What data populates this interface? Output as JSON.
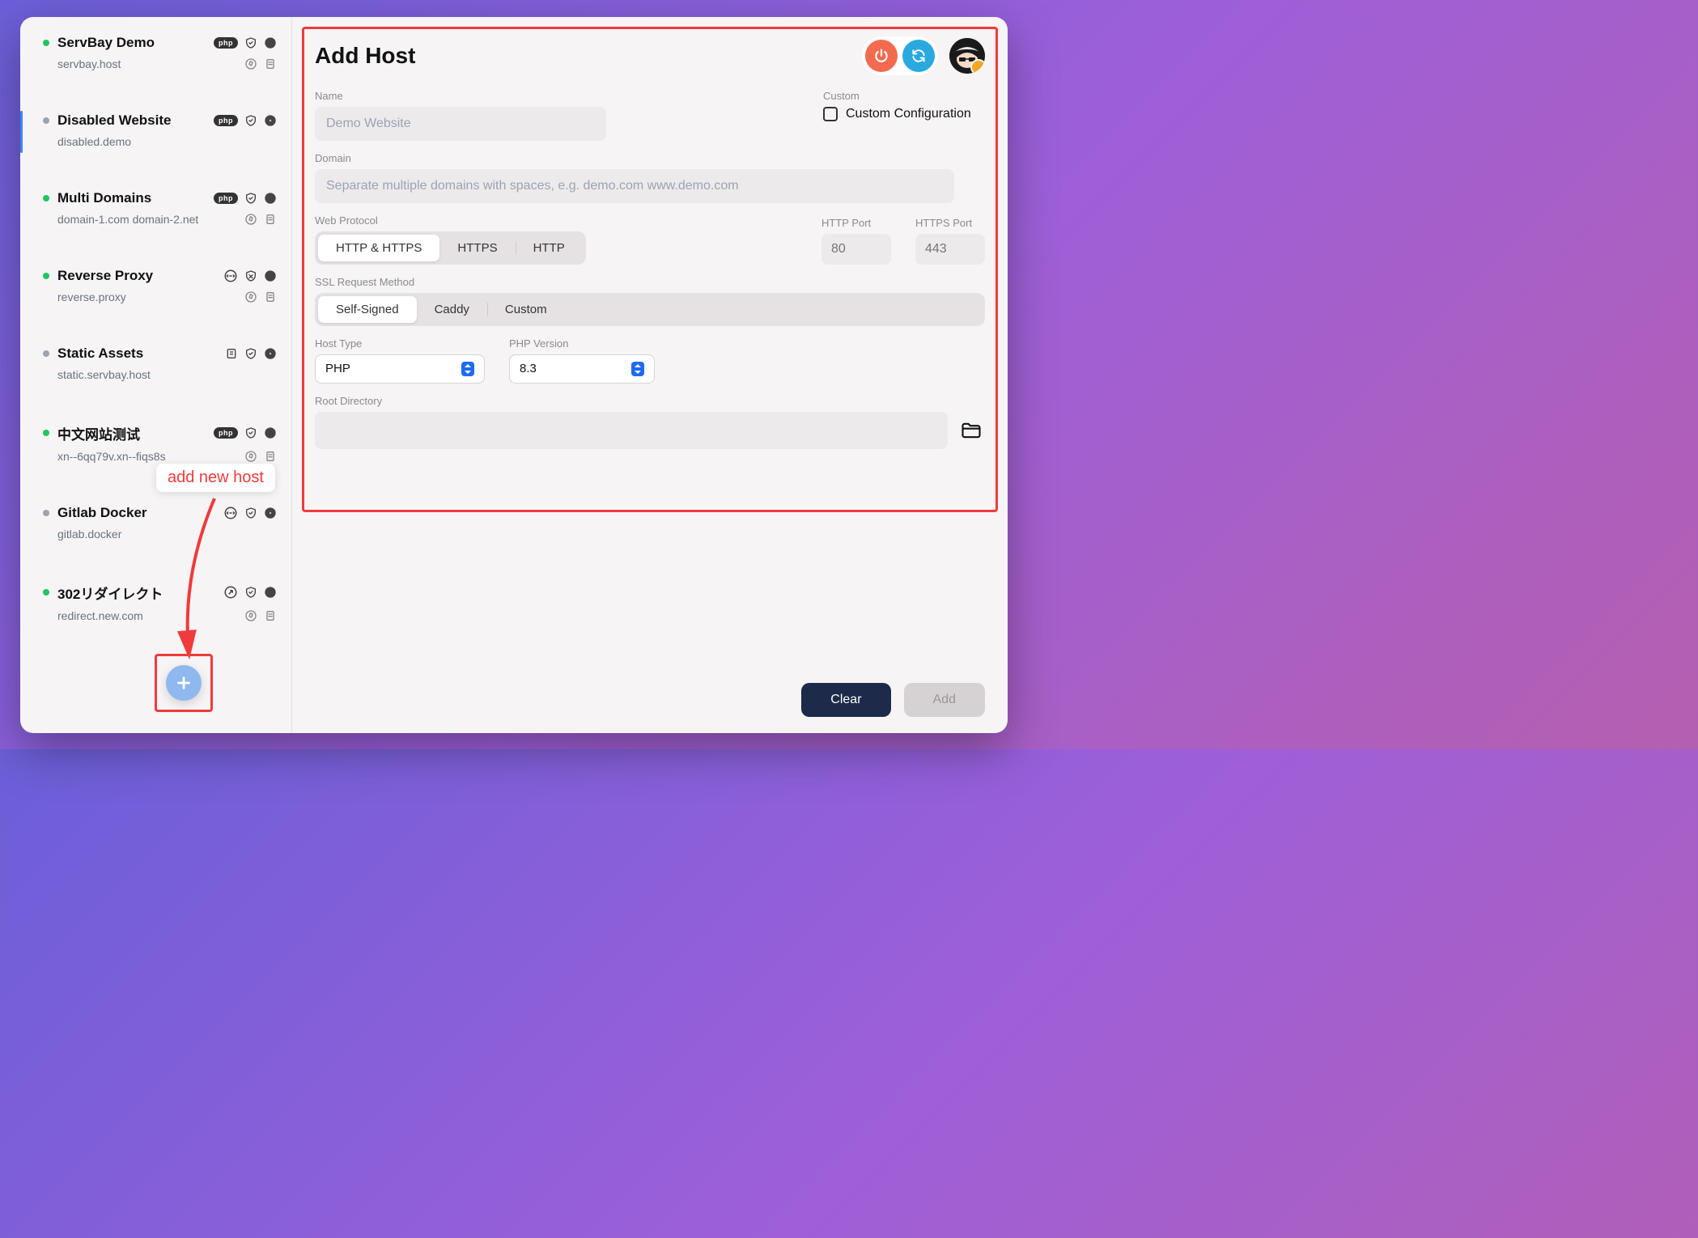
{
  "sidebar": {
    "items": [
      {
        "name": "ServBay Demo",
        "domain": "servbay.host",
        "status": "green",
        "badge": "php",
        "row1_icons": [
          "shield",
          "pause"
        ],
        "row2_icons": [
          "compass",
          "doc"
        ]
      },
      {
        "name": "Disabled Website",
        "domain": "disabled.demo",
        "status": "gray",
        "badge": "php",
        "row1_icons": [
          "shield",
          "play"
        ],
        "row2_icons": []
      },
      {
        "name": "Multi Domains",
        "domain": "domain-1.com domain-2.net",
        "status": "green",
        "badge": "php",
        "row1_icons": [
          "shield",
          "pause"
        ],
        "row2_icons": [
          "compass",
          "doc"
        ]
      },
      {
        "name": "Reverse Proxy",
        "domain": "reverse.proxy",
        "status": "green",
        "badge": "swap",
        "row1_icons": [
          "shield-x",
          "pause"
        ],
        "row2_icons": [
          "compass",
          "doc"
        ]
      },
      {
        "name": "Static Assets",
        "domain": "static.servbay.host",
        "status": "gray",
        "badge": "static",
        "row1_icons": [
          "shield",
          "play"
        ],
        "row2_icons": []
      },
      {
        "name": "中文网站测试",
        "domain": "xn--6qq79v.xn--fiqs8s",
        "status": "green",
        "badge": "php",
        "row1_icons": [
          "shield",
          "pause"
        ],
        "row2_icons": [
          "compass",
          "doc"
        ]
      },
      {
        "name": "Gitlab Docker",
        "domain": "gitlab.docker",
        "status": "gray",
        "badge": "swap",
        "row1_icons": [
          "shield",
          "play"
        ],
        "row2_icons": []
      },
      {
        "name": "302リダイレクト",
        "domain": "redirect.new.com",
        "status": "green",
        "badge": "redirect",
        "row1_icons": [
          "shield",
          "pause"
        ],
        "row2_icons": [
          "compass",
          "doc"
        ]
      }
    ]
  },
  "tooltip": "add new host",
  "main": {
    "title": "Add Host",
    "labels": {
      "name": "Name",
      "domain": "Domain",
      "web_protocol": "Web Protocol",
      "http_port": "HTTP Port",
      "https_port": "HTTPS Port",
      "ssl": "SSL Request Method",
      "host_type": "Host Type",
      "php_version": "PHP Version",
      "root": "Root Directory",
      "custom": "Custom"
    },
    "placeholders": {
      "name": "Demo Website",
      "domain": "Separate multiple domains with spaces, e.g. demo.com www.demo.com",
      "http_port": "80",
      "https_port": "443"
    },
    "custom_config": "Custom Configuration",
    "web_protocol_opts": [
      "HTTP & HTTPS",
      "HTTPS",
      "HTTP"
    ],
    "web_protocol_active": 0,
    "ssl_opts": [
      "Self-Signed",
      "Caddy",
      "Custom"
    ],
    "ssl_active": 0,
    "host_type_value": "PHP",
    "php_version_value": "8.3"
  },
  "footer": {
    "clear": "Clear",
    "add": "Add"
  }
}
